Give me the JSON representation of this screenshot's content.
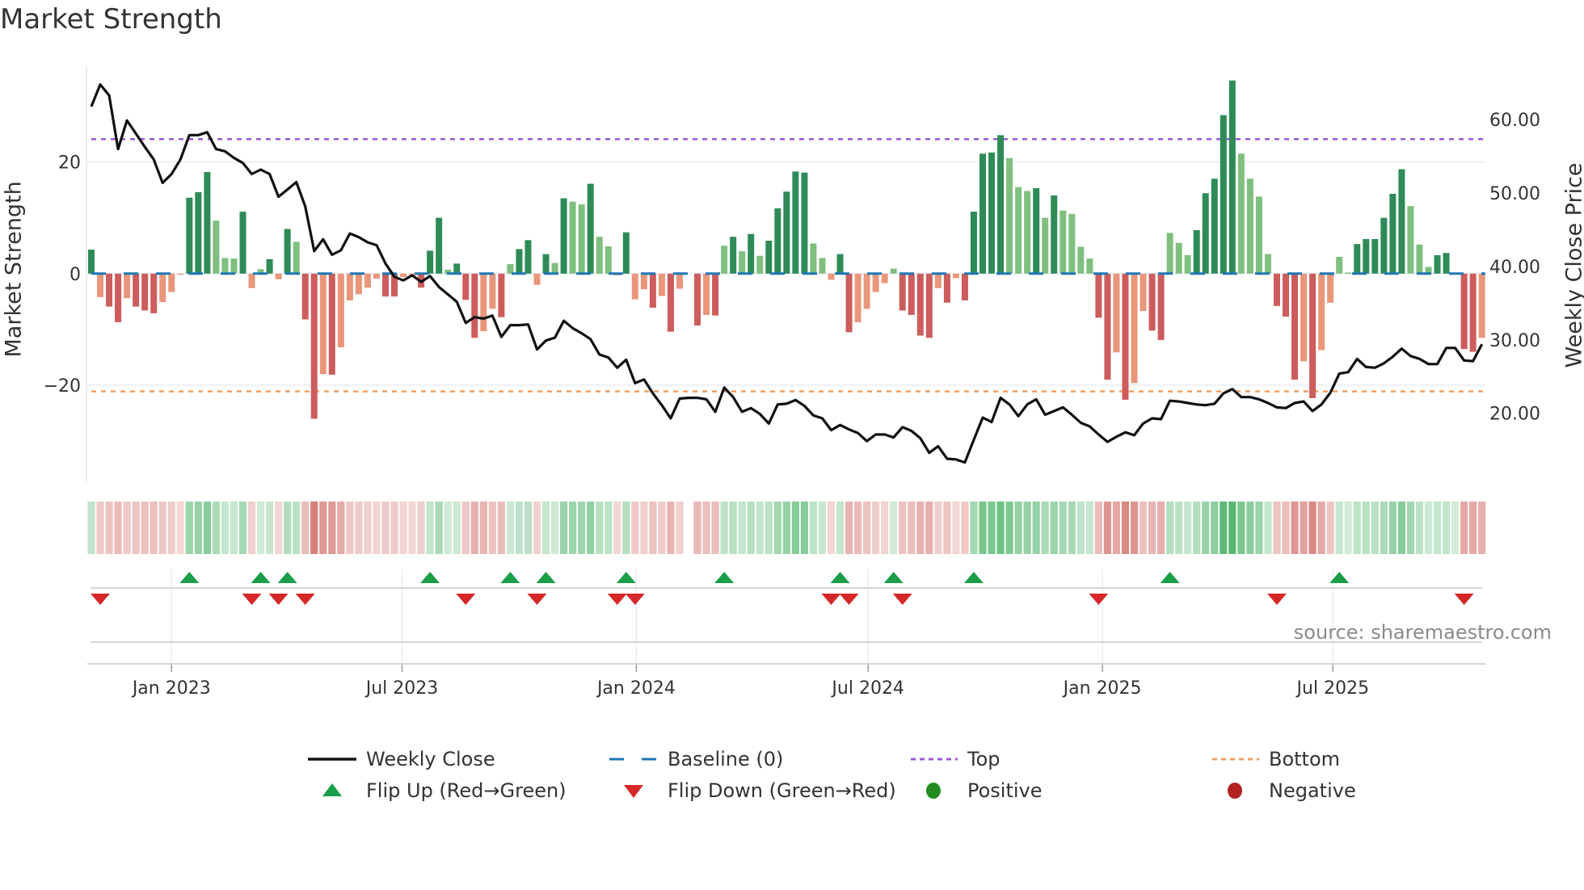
{
  "title": "Market Strength",
  "source": "source: sharemaestro.com",
  "chart_data": {
    "type": "bar",
    "title": "Market Strength",
    "ylabel": "Market Strength",
    "y2label": "Weekly Close Price",
    "ylim": [
      -37.5,
      37.3
    ],
    "y2lim": [
      10.5,
      67.4
    ],
    "yticks": [
      {
        "v": 20,
        "label": "20"
      },
      {
        "v": 0,
        "label": "0"
      },
      {
        "v": -20,
        "label": "−20"
      }
    ],
    "y2ticks": [
      {
        "v": 60,
        "label": "60.00"
      },
      {
        "v": 50,
        "label": "50.00"
      },
      {
        "v": 40,
        "label": "40.00"
      },
      {
        "v": 30,
        "label": "30.00"
      },
      {
        "v": 20,
        "label": "20.00"
      }
    ],
    "x_first_week": "2022-10-30",
    "xticks": [
      {
        "date": "2023-01-01",
        "label": "Jan 2023"
      },
      {
        "date": "2023-07-01",
        "label": "Jul 2023"
      },
      {
        "date": "2024-01-01",
        "label": "Jan 2024"
      },
      {
        "date": "2024-07-01",
        "label": "Jul 2024"
      },
      {
        "date": "2025-01-01",
        "label": "Jan 2025"
      },
      {
        "date": "2025-07-01",
        "label": "Jul 2025"
      }
    ],
    "top_level": 24.1,
    "bottom_level": -21.1,
    "baseline": 0,
    "strength": [
      4.3,
      -4.2,
      -5.9,
      -8.7,
      -4.4,
      -5.9,
      -6.6,
      -7.1,
      -5.1,
      -3.3,
      -0.2,
      13.6,
      14.6,
      18.2,
      9.5,
      2.8,
      2.7,
      11.1,
      -2.6,
      0.8,
      2.6,
      -1.0,
      8.0,
      5.7,
      -8.2,
      -26,
      -18,
      -18.1,
      -13.2,
      -4.8,
      -3.7,
      -2.5,
      -0.9,
      -4.1,
      -4.1,
      -0.6,
      -0.3,
      -2.5,
      4.1,
      10,
      0.7,
      1.8,
      -4.7,
      -11.5,
      -10.3,
      -6.3,
      -7.8,
      1.7,
      4.4,
      6,
      -2,
      3.5,
      1.9,
      13.5,
      12.9,
      12.4,
      16.1,
      6.6,
      4.9,
      -0.3,
      7.4,
      -4.6,
      -2.8,
      -6.1,
      -4,
      -10.4,
      -2.7,
      null,
      -9.3,
      -7.4,
      -7.5,
      5,
      6.6,
      4,
      7.1,
      3.2,
      5.9,
      11.7,
      14.7,
      18.3,
      18.1,
      5.4,
      2.8,
      -1.1,
      3.5,
      -10.5,
      -8.7,
      -6.3,
      -3.3,
      -1.7,
      0.9,
      -6.6,
      -7.4,
      -11.1,
      -11.5,
      -2.6,
      -5.2,
      -0.8,
      -4.8,
      11.1,
      21.5,
      21.7,
      24.8,
      20.7,
      15.5,
      14.8,
      15.3,
      10,
      14,
      11.3,
      10.7,
      4.8,
      2.7,
      -7.9,
      -19,
      -14.1,
      -22.6,
      -19.6,
      -6.7,
      -10.2,
      -11.9,
      7.3,
      5.5,
      3.3,
      7.8,
      14.4,
      17,
      28.4,
      34.6,
      21.5,
      17,
      13.8,
      3.5,
      -5.8,
      -7.7,
      -19,
      -15.7,
      -22.3,
      -13.7,
      -5.2,
      3,
      0.2,
      5.3,
      6.2,
      6.2,
      10,
      14.3,
      18.7,
      12.1,
      5.2,
      1.2,
      3.3,
      3.7,
      0.1,
      -13.5,
      -14,
      -11.5
    ],
    "weekly_close": [
      61.8,
      64.8,
      63.3,
      56.0,
      59.9,
      58.1,
      56.3,
      54.6,
      51.4,
      52.6,
      54.6,
      57.9,
      57.9,
      58.3,
      56.0,
      55.7,
      54.8,
      54.1,
      52.6,
      53.2,
      52.6,
      49.5,
      50.5,
      51.5,
      48.2,
      42.1,
      43.7,
      41.6,
      42.2,
      44.5,
      44.0,
      43.3,
      42.9,
      40.4,
      38.6,
      38.1,
      38.8,
      37.9,
      38.7,
      37.2,
      36.2,
      35.2,
      32.3,
      33.1,
      32.9,
      33.3,
      30.4,
      32.0,
      32.0,
      32.1,
      28.7,
      29.9,
      30.3,
      32.6,
      31.6,
      30.9,
      30.1,
      28.0,
      27.6,
      26.2,
      27.3,
      24.1,
      24.6,
      22.7,
      21.1,
      19.3,
      22.0,
      22.1,
      22.1,
      21.9,
      20.2,
      23.5,
      22.2,
      20.2,
      20.7,
      19.9,
      18.6,
      21.2,
      21.3,
      21.8,
      21.0,
      19.7,
      19.3,
      17.7,
      18.4,
      17.8,
      17.3,
      16.2,
      17.1,
      17.1,
      16.7,
      18.1,
      17.6,
      16.6,
      14.6,
      15.5,
      13.8,
      13.7,
      13.3,
      16.4,
      19.4,
      18.8,
      22.1,
      21.2,
      19.6,
      21.2,
      21.9,
      19.8,
      20.3,
      20.8,
      19.8,
      18.7,
      18.2,
      17.1,
      16.1,
      16.8,
      17.4,
      17.0,
      18.6,
      19.3,
      19.2,
      21.7,
      21.6,
      21.4,
      21.2,
      21.1,
      21.3,
      22.7,
      23.3,
      22.2,
      22.2,
      21.9,
      21.4,
      20.8,
      20.7,
      21.4,
      21.6,
      20.3,
      21.2,
      22.8,
      25.4,
      25.6,
      27.4,
      26.3,
      26.2,
      26.8,
      27.7,
      28.8,
      27.8,
      27.4,
      26.7,
      26.7,
      28.9,
      28.9,
      27.2,
      27.1,
      29.4
    ],
    "flip_up_weeks": [
      12,
      20,
      23,
      39,
      48,
      52,
      61,
      72,
      85,
      91,
      100,
      122,
      141
    ],
    "flip_down_weeks": [
      2,
      19,
      22,
      25,
      43,
      51,
      60,
      62,
      84,
      86,
      92,
      114,
      134,
      155
    ],
    "colors": {
      "pos_strong": "#2e8b57",
      "pos_weak": "#7fbf7f",
      "neg_strong": "#cd5c5c",
      "neg_weak": "#e9967a",
      "close": "#111111",
      "baseline": "#1f77b4",
      "top": "#9b59d6",
      "bottom": "#f0a060",
      "flip_up": "#1a9e4a",
      "flip_down": "#d62728",
      "positive": "#228b22",
      "negative": "#b22222"
    },
    "legend": [
      {
        "key": "close",
        "label": "Weekly Close"
      },
      {
        "key": "baseline",
        "label": "Baseline (0)"
      },
      {
        "key": "top",
        "label": "Top"
      },
      {
        "key": "bottom",
        "label": "Bottom"
      },
      {
        "key": "flip_up",
        "label": "Flip Up (Red→Green)"
      },
      {
        "key": "flip_down",
        "label": "Flip Down (Green→Red)"
      },
      {
        "key": "positive",
        "label": "Positive"
      },
      {
        "key": "negative",
        "label": "Negative"
      }
    ],
    "legend_position": "bottom-center"
  }
}
